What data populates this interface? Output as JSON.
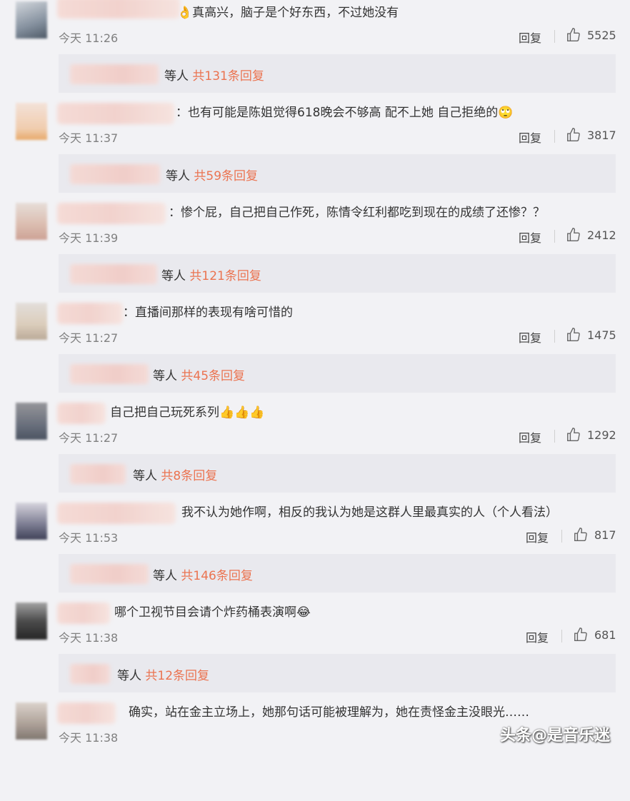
{
  "comments": [
    {
      "text": "真高兴，脑子是个好东西，不过她没有",
      "emoji": "👌",
      "time": "今天 11:26",
      "reply_label": "回复",
      "likes": "5525",
      "sub_prefix": "等人",
      "sub_link": "共131条回复"
    },
    {
      "text": "也有可能是陈姐觉得618晚会不够高 配不上她 自己拒绝的",
      "emoji": "🙄",
      "time": "今天 11:37",
      "reply_label": "回复",
      "likes": "3817",
      "sub_prefix": "等人",
      "sub_link": "共59条回复"
    },
    {
      "text": "惨个屁，自己把自己作死，陈情令红利都吃到现在的成绩了还惨？？",
      "emoji": "",
      "time": "今天 11:39",
      "reply_label": "回复",
      "likes": "2412",
      "sub_prefix": "等人",
      "sub_link": "共121条回复"
    },
    {
      "text": "直播间那样的表现有啥可惜的",
      "emoji": "",
      "time": "今天 11:27",
      "reply_label": "回复",
      "likes": "1475",
      "sub_prefix": "等人",
      "sub_link": "共45条回复"
    },
    {
      "text": "自己把自己玩死系列",
      "emoji": "👍👍👍",
      "time": "今天 11:27",
      "reply_label": "回复",
      "likes": "1292",
      "sub_prefix": "等人",
      "sub_link": "共8条回复"
    },
    {
      "text": "我不认为她作啊，相反的我认为她是这群人里最真实的人（个人看法）",
      "emoji": "",
      "time": "今天 11:53",
      "reply_label": "回复",
      "likes": "817",
      "sub_prefix": "等人",
      "sub_link": "共146条回复"
    },
    {
      "text": "哪个卫视节目会请个炸药桶表演啊",
      "emoji": "😂",
      "time": "今天 11:38",
      "reply_label": "回复",
      "likes": "681",
      "sub_prefix": "等人",
      "sub_link": "共12条回复"
    },
    {
      "text": "确实，站在金主立场上，她那句话可能被理解为，她在责怪金主没眼光……",
      "emoji": "",
      "time": "今天 11:38",
      "reply_label": "",
      "likes": "",
      "sub_prefix": "",
      "sub_link": ""
    }
  ],
  "watermark": "头条@是音乐迷"
}
